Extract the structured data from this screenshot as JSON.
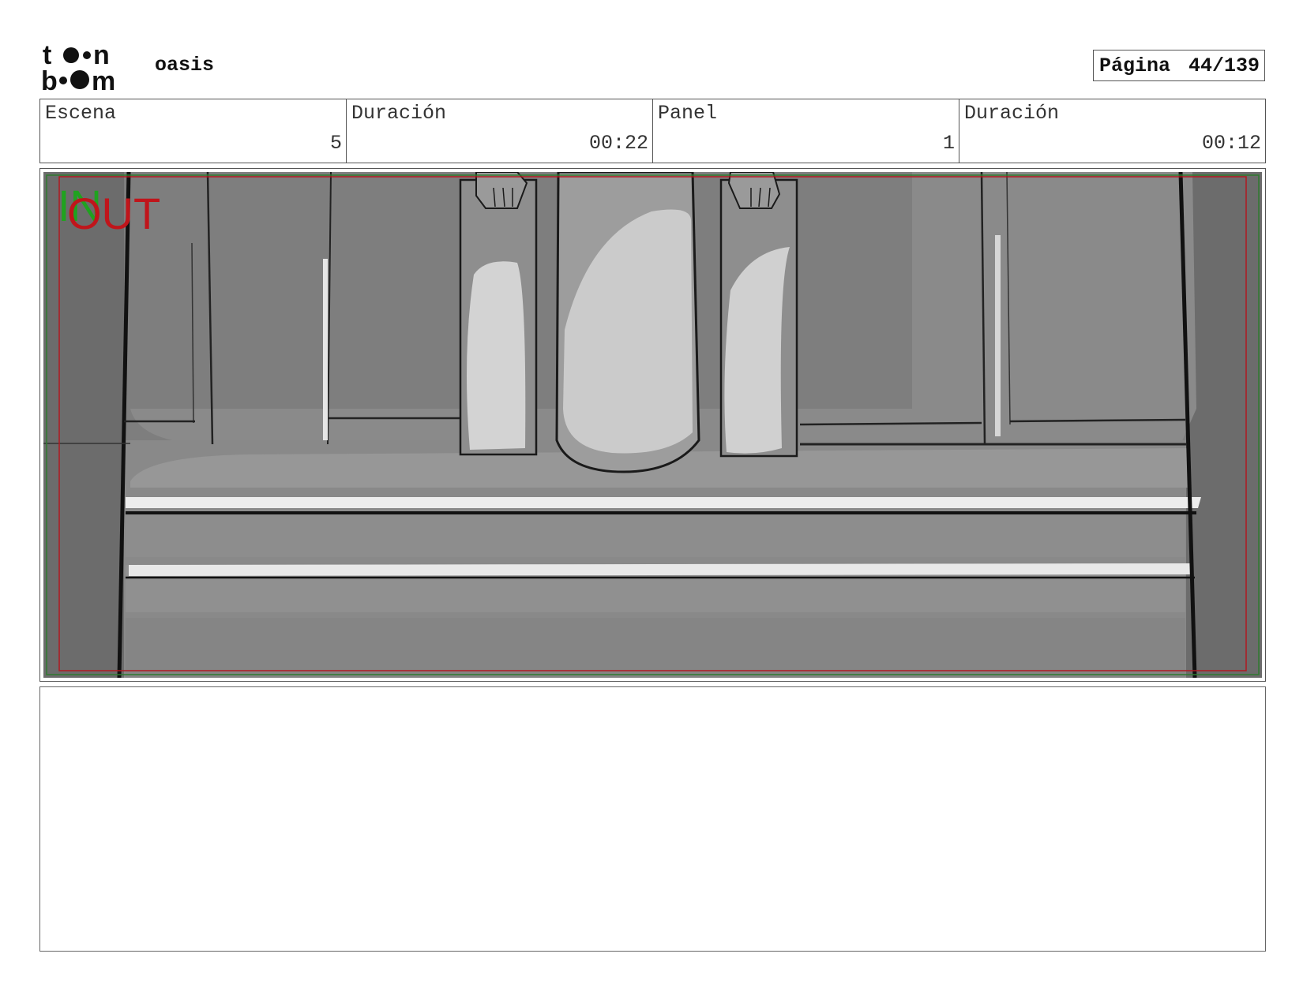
{
  "header": {
    "logo_top": "t",
    "logo_top_end": "n",
    "logo_bottom_start": "b",
    "logo_bottom_end": "m",
    "project_name": "oasis",
    "page_label": "Página",
    "page_value": "44/139"
  },
  "info": {
    "scene_label": "Escena",
    "scene_value": "5",
    "scene_duration_label": "Duración",
    "scene_duration_value": "00:22",
    "panel_label": "Panel",
    "panel_value": "1",
    "panel_duration_label": "Duración",
    "panel_duration_value": "00:12"
  },
  "panel": {
    "in_marker": "IN",
    "out_marker": "OUT",
    "in_color": "#1fa31f",
    "out_color": "#c0151b"
  },
  "notes": {}
}
